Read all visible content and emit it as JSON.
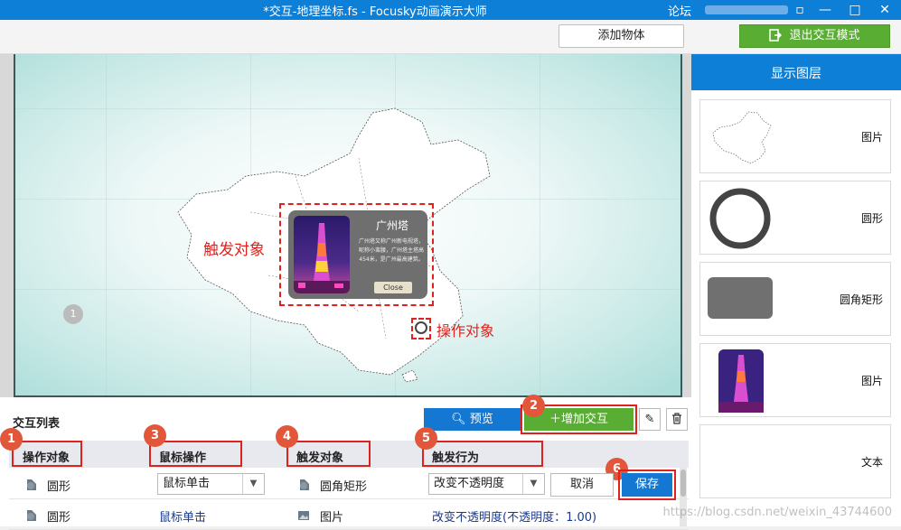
{
  "window": {
    "title": "*交互-地理坐标.fs - Focusky动画演示大师",
    "forum_label": "论坛",
    "controls": {
      "restore": "▫",
      "minimize": "—",
      "maximize": "□",
      "close": "✕"
    }
  },
  "toolbar": {
    "add_object_label": "添加物体",
    "exit_interaction_label": "退出交互模式"
  },
  "canvas": {
    "trigger_label": "触发对象",
    "operation_label": "操作对象",
    "page_number": "1",
    "popup": {
      "title": "广州塔",
      "text": "广州塔又称广州新电视塔，昵称小蛮腰，广州塔主塔高454米，是广州最高建筑。",
      "close_label": "Close"
    }
  },
  "layers_panel": {
    "title": "显示图层",
    "items": [
      {
        "name": "图片",
        "preview": "map-image-icon"
      },
      {
        "name": "圆形",
        "preview": "circle-icon"
      },
      {
        "name": "圆角矩形",
        "preview": "rounded-rect-icon"
      },
      {
        "name": "图片",
        "preview": "tower-image-icon"
      },
      {
        "name": "文本",
        "preview": "text-icon"
      }
    ]
  },
  "interaction_panel": {
    "list_title": "交互列表",
    "preview_label": "预览",
    "add_interaction_label": "增加交互",
    "headers": {
      "operation_object": "操作对象",
      "mouse_action": "鼠标操作",
      "trigger_object": "触发对象",
      "trigger_behavior": "触发行为"
    },
    "badges": [
      "1",
      "2",
      "3",
      "4",
      "5",
      "6"
    ],
    "editing_row": {
      "operation_object": "圆形",
      "mouse_action": "鼠标单击",
      "trigger_object": "圆角矩形",
      "trigger_behavior": "改变不透明度",
      "cancel_label": "取消",
      "save_label": "保存"
    },
    "rows": [
      {
        "operation_object": "圆形",
        "mouse_action": "鼠标单击",
        "trigger_object": "图片",
        "trigger_behavior": "改变不透明度(不透明度：1.00)"
      }
    ]
  },
  "watermark": "https://blog.csdn.net/weixin_43744600",
  "colors": {
    "titlebar": "#0d7fd6",
    "green": "#5aad33",
    "blue": "#1478d2",
    "highlight_red": "#e0221e",
    "badge": "#e2563a"
  }
}
